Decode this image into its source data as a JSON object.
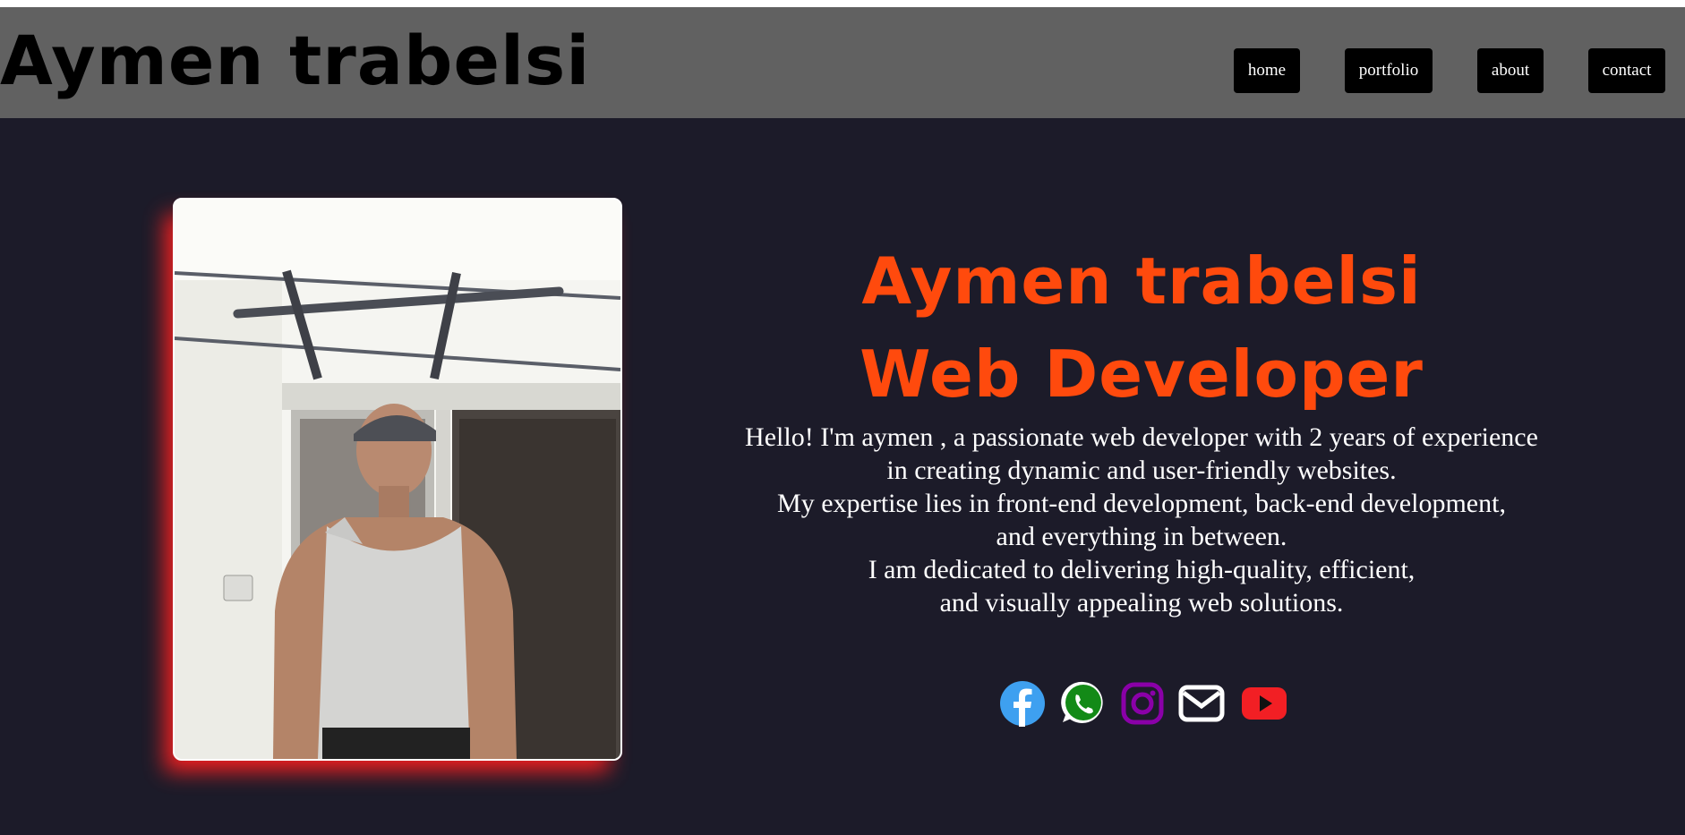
{
  "header": {
    "brand": "Aymen trabelsi",
    "nav": [
      {
        "label": "home"
      },
      {
        "label": "portfolio"
      },
      {
        "label": "about"
      },
      {
        "label": "contact"
      }
    ]
  },
  "hero": {
    "name": "Aymen trabelsi",
    "role": "Web Developer",
    "bio_lines": [
      "Hello! I'm aymen , a passionate web developer with 2 years of experience",
      "in creating dynamic and user-friendly websites.",
      "My expertise lies in front-end development, back-end development,",
      "and everything in between.",
      "I am dedicated to delivering high-quality, efficient,",
      "and visually appealing web solutions."
    ]
  },
  "social": [
    {
      "icon": "facebook-icon",
      "color": "#1877f2"
    },
    {
      "icon": "whatsapp-icon",
      "color": "#25d366"
    },
    {
      "icon": "instagram-icon",
      "color": "#8a00a8"
    },
    {
      "icon": "mail-icon",
      "color": "#ffffff"
    },
    {
      "icon": "youtube-icon",
      "color": "#ff1a1a"
    }
  ],
  "colors": {
    "background": "#1c1b29",
    "header": "#616161",
    "accent": "#ff4a0d",
    "photo_glow": "#ff2020"
  }
}
